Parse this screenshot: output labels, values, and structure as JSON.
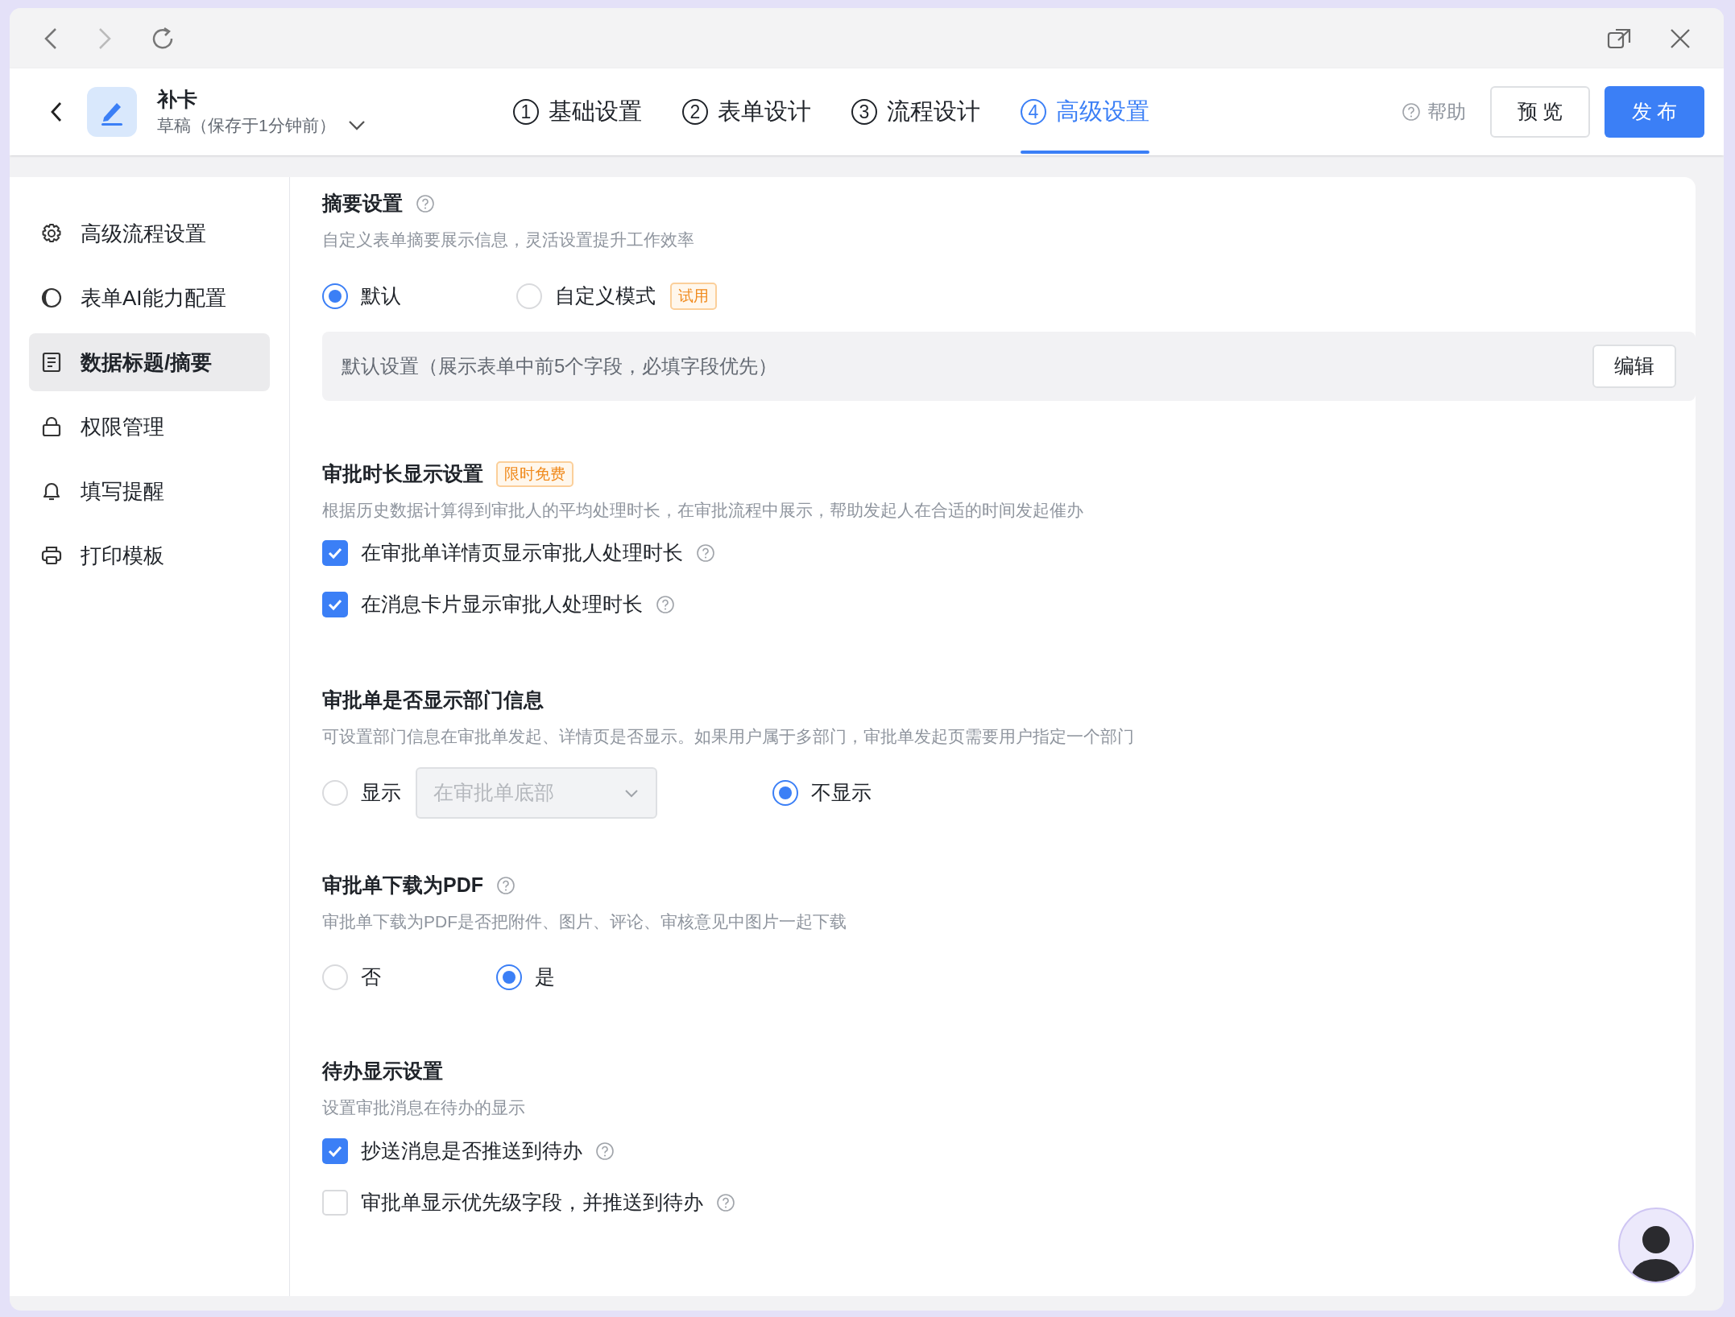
{
  "header": {
    "title": "补卡",
    "status": "草稿（保存于1分钟前）",
    "steps": [
      {
        "number": "1",
        "label": "基础设置",
        "selected": false
      },
      {
        "number": "2",
        "label": "表单设计",
        "selected": false
      },
      {
        "number": "3",
        "label": "流程设计",
        "selected": false
      },
      {
        "number": "4",
        "label": "高级设置",
        "selected": true
      }
    ],
    "help": "帮助",
    "preview_button": "预 览",
    "publish_button": "发 布"
  },
  "sidebar": {
    "items": [
      {
        "kind": "gear",
        "label": "高级流程设置",
        "selected": false
      },
      {
        "kind": "contrast",
        "label": "表单AI能力配置",
        "selected": false
      },
      {
        "kind": "document",
        "label": "数据标题/摘要",
        "selected": true
      },
      {
        "kind": "lock",
        "label": "权限管理",
        "selected": false
      },
      {
        "kind": "bell",
        "label": "填写提醒",
        "selected": false
      },
      {
        "kind": "printer",
        "label": "打印模板",
        "selected": false
      }
    ]
  },
  "sections": [
    {
      "kind": "radio_group",
      "title": "摘要设置",
      "help": true,
      "description": "自定义表单摘要展示信息，灵活设置提升工作效率",
      "options": [
        {
          "label": "默认",
          "selected": true
        },
        {
          "label": "自定义模式",
          "badge": "试用",
          "selected": false
        }
      ],
      "summary_box": {
        "text": "默认设置（展示表单中前5个字段，必填字段优先）",
        "button": "编辑"
      }
    },
    {
      "kind": "checkbox_list",
      "title": "审批时长显示设置",
      "badge": "限时免费",
      "description": "根据历史数据计算得到审批人的平均处理时长，在审批流程中展示，帮助发起人在合适的时间发起催办",
      "options": [
        {
          "label": "在审批单详情页显示审批人处理时长",
          "checked": true,
          "help": true
        },
        {
          "label": "在消息卡片显示审批人处理时长",
          "checked": true,
          "help": true
        }
      ]
    },
    {
      "kind": "radio_group",
      "title": "审批单是否显示部门信息",
      "description": "可设置部门信息在审批单发起、详情页是否显示。如果用户属于多部门，审批单发起页需要用户指定一个部门",
      "options": [
        {
          "label": "显示",
          "selected": false,
          "dropdown": {
            "value": "在审批单底部",
            "disabled": true
          }
        },
        {
          "label": "不显示",
          "selected": true
        }
      ]
    },
    {
      "kind": "radio_group",
      "title": "审批单下载为PDF",
      "help": true,
      "description": "审批单下载为PDF是否把附件、图片、评论、审核意见中图片一起下载",
      "options": [
        {
          "label": "否",
          "selected": false
        },
        {
          "label": "是",
          "selected": true
        }
      ]
    },
    {
      "kind": "checkbox_list",
      "title": "待办显示设置",
      "description": "设置审批消息在待办的显示",
      "options": [
        {
          "label": "抄送消息是否推送到待办",
          "checked": true,
          "help": true
        },
        {
          "label": "审批单显示优先级字段，并推送到待办",
          "checked": false,
          "help": true
        }
      ]
    }
  ]
}
